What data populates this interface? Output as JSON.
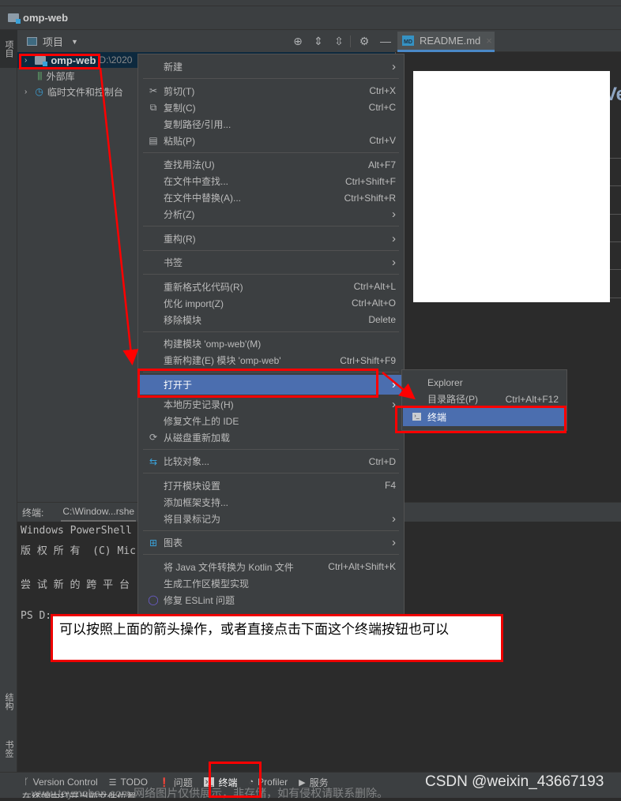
{
  "title_bar": {
    "project_name": "omp-web"
  },
  "left_stripe": {
    "project_tab": "项目",
    "structure_tab": "结构",
    "bookmarks_tab": "书签"
  },
  "project_panel": {
    "view_label": "项目",
    "tree": [
      {
        "label": "omp-web",
        "path": "D:\\2020",
        "expanded": false,
        "selected": true
      },
      {
        "label": "外部库"
      },
      {
        "label": "临时文件和控制台",
        "expanded": false
      }
    ]
  },
  "editor": {
    "tab_label": "README.md",
    "partial_heading": "Ve"
  },
  "context_menu": {
    "items": [
      {
        "label": "新建",
        "submenu": true
      },
      {
        "sep": true
      },
      {
        "label": "剪切(T)",
        "shortcut": "Ctrl+X",
        "icon": "scissors-icon",
        "glyph": "✂"
      },
      {
        "label": "复制(C)",
        "shortcut": "Ctrl+C",
        "icon": "copy-icon",
        "glyph": "⧉"
      },
      {
        "label": "复制路径/引用..."
      },
      {
        "label": "粘贴(P)",
        "shortcut": "Ctrl+V",
        "icon": "paste-icon",
        "glyph": "▤"
      },
      {
        "sep": true
      },
      {
        "label": "查找用法(U)",
        "shortcut": "Alt+F7"
      },
      {
        "label": "在文件中查找...",
        "shortcut": "Ctrl+Shift+F"
      },
      {
        "label": "在文件中替换(A)...",
        "shortcut": "Ctrl+Shift+R"
      },
      {
        "label": "分析(Z)",
        "submenu": true
      },
      {
        "sep": true
      },
      {
        "label": "重构(R)",
        "submenu": true
      },
      {
        "sep": true
      },
      {
        "label": "书签",
        "submenu": true
      },
      {
        "sep": true
      },
      {
        "label": "重新格式化代码(R)",
        "shortcut": "Ctrl+Alt+L"
      },
      {
        "label": "优化 import(Z)",
        "shortcut": "Ctrl+Alt+O"
      },
      {
        "label": "移除模块",
        "shortcut": "Delete"
      },
      {
        "sep": true
      },
      {
        "label": "构建模块 'omp-web'(M)"
      },
      {
        "label": "重新构建(E) 模块 'omp-web'",
        "shortcut": "Ctrl+Shift+F9"
      },
      {
        "sep": true
      },
      {
        "label": "打开于",
        "submenu": true,
        "selected": true
      },
      {
        "label": "本地历史记录(H)",
        "submenu": true
      },
      {
        "label": "修复文件上的 IDE"
      },
      {
        "label": "从磁盘重新加载",
        "icon": "reload-icon",
        "glyph": "⟳"
      },
      {
        "sep": true
      },
      {
        "label": "比较对象...",
        "shortcut": "Ctrl+D",
        "icon": "compare-icon",
        "glyph": "⇆"
      },
      {
        "sep": true
      },
      {
        "label": "打开模块设置",
        "shortcut": "F4"
      },
      {
        "label": "添加框架支持..."
      },
      {
        "label": "将目录标记为",
        "submenu": true
      },
      {
        "sep": true
      },
      {
        "label": "图表",
        "submenu": true,
        "icon": "diagram-icon",
        "glyph": "⊞"
      },
      {
        "sep": true
      },
      {
        "label": "将 Java 文件转换为 Kotlin 文件",
        "shortcut": "Ctrl+Alt+Shift+K"
      },
      {
        "label": "生成工作区模型实现"
      },
      {
        "label": "修复 ESLint 问题",
        "icon": "eslint-icon",
        "glyph": "◯"
      }
    ]
  },
  "submenu": {
    "items": [
      {
        "label": "Explorer"
      },
      {
        "label": "目录路径(P)",
        "shortcut": "Ctrl+Alt+F12"
      },
      {
        "label": "终端",
        "selected": true
      }
    ]
  },
  "terminal": {
    "header_label": "终端:",
    "tab_label": "C:\\Window...rshe",
    "lines": [
      "Windows PowerShell",
      "版 权 所 有  (C) Micros",
      "",
      "尝 试 新 的 跨 平 台  Powe",
      "",
      "PS D:"
    ]
  },
  "annotation": {
    "text": "可以按照上面的箭头操作，或者直接点击下面这个终端按钮也可以"
  },
  "bottom_toolbar": {
    "items": [
      "Version Control",
      "TODO",
      "问题",
      "终端",
      "Profiler",
      "服务"
    ]
  },
  "status_bar": {
    "text": "在终端中打开当前文件位置"
  },
  "watermark": {
    "text": "www.toymoban.com 网络图片仅供展示，非存储，如有侵权请联系删除。"
  },
  "csdn_credit": "CSDN @weixin_43667193",
  "colors": {
    "selection": "#4b6eaf",
    "annotation_red": "#ff0000",
    "panel_bg": "#3c3f41",
    "editor_bg": "#2b2b2b"
  }
}
